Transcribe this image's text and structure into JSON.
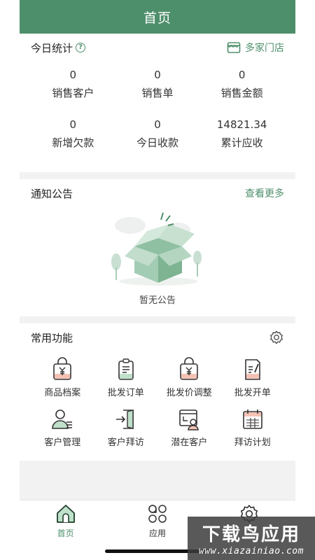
{
  "header": {
    "title": "首页"
  },
  "stats": {
    "title": "今日统计",
    "help_glyph": "?",
    "stores_link": "多家门店",
    "items": [
      {
        "value": "0",
        "label": "销售客户"
      },
      {
        "value": "0",
        "label": "销售单"
      },
      {
        "value": "0",
        "label": "销售金额"
      },
      {
        "value": "0",
        "label": "新增欠款"
      },
      {
        "value": "0",
        "label": "今日收款"
      },
      {
        "value": "14821.34",
        "label": "累计应收"
      }
    ]
  },
  "notice": {
    "title": "通知公告",
    "more_link": "查看更多",
    "empty_text": "暂无公告"
  },
  "functions": {
    "title": "常用功能",
    "items": [
      {
        "label": "商品档案",
        "icon": "bag-yuan-icon"
      },
      {
        "label": "批发订单",
        "icon": "clipboard-icon"
      },
      {
        "label": "批发价调整",
        "icon": "bag-yuan-icon"
      },
      {
        "label": "批发开单",
        "icon": "document-edit-icon"
      },
      {
        "label": "客户管理",
        "icon": "user-list-icon"
      },
      {
        "label": "客户拜访",
        "icon": "door-enter-icon"
      },
      {
        "label": "潜在客户",
        "icon": "user-window-icon"
      },
      {
        "label": "拜访计划",
        "icon": "calendar-icon"
      }
    ]
  },
  "tabbar": {
    "items": [
      {
        "label": "首页",
        "icon": "home-icon",
        "active": true
      },
      {
        "label": "应用",
        "icon": "apps-icon",
        "active": false
      }
    ]
  },
  "watermark": {
    "title": "下载鸟应用",
    "url": "www.xiazainiao.com"
  },
  "colors": {
    "brand": "#4e8f6b",
    "accent_light": "#a8cdb6"
  }
}
